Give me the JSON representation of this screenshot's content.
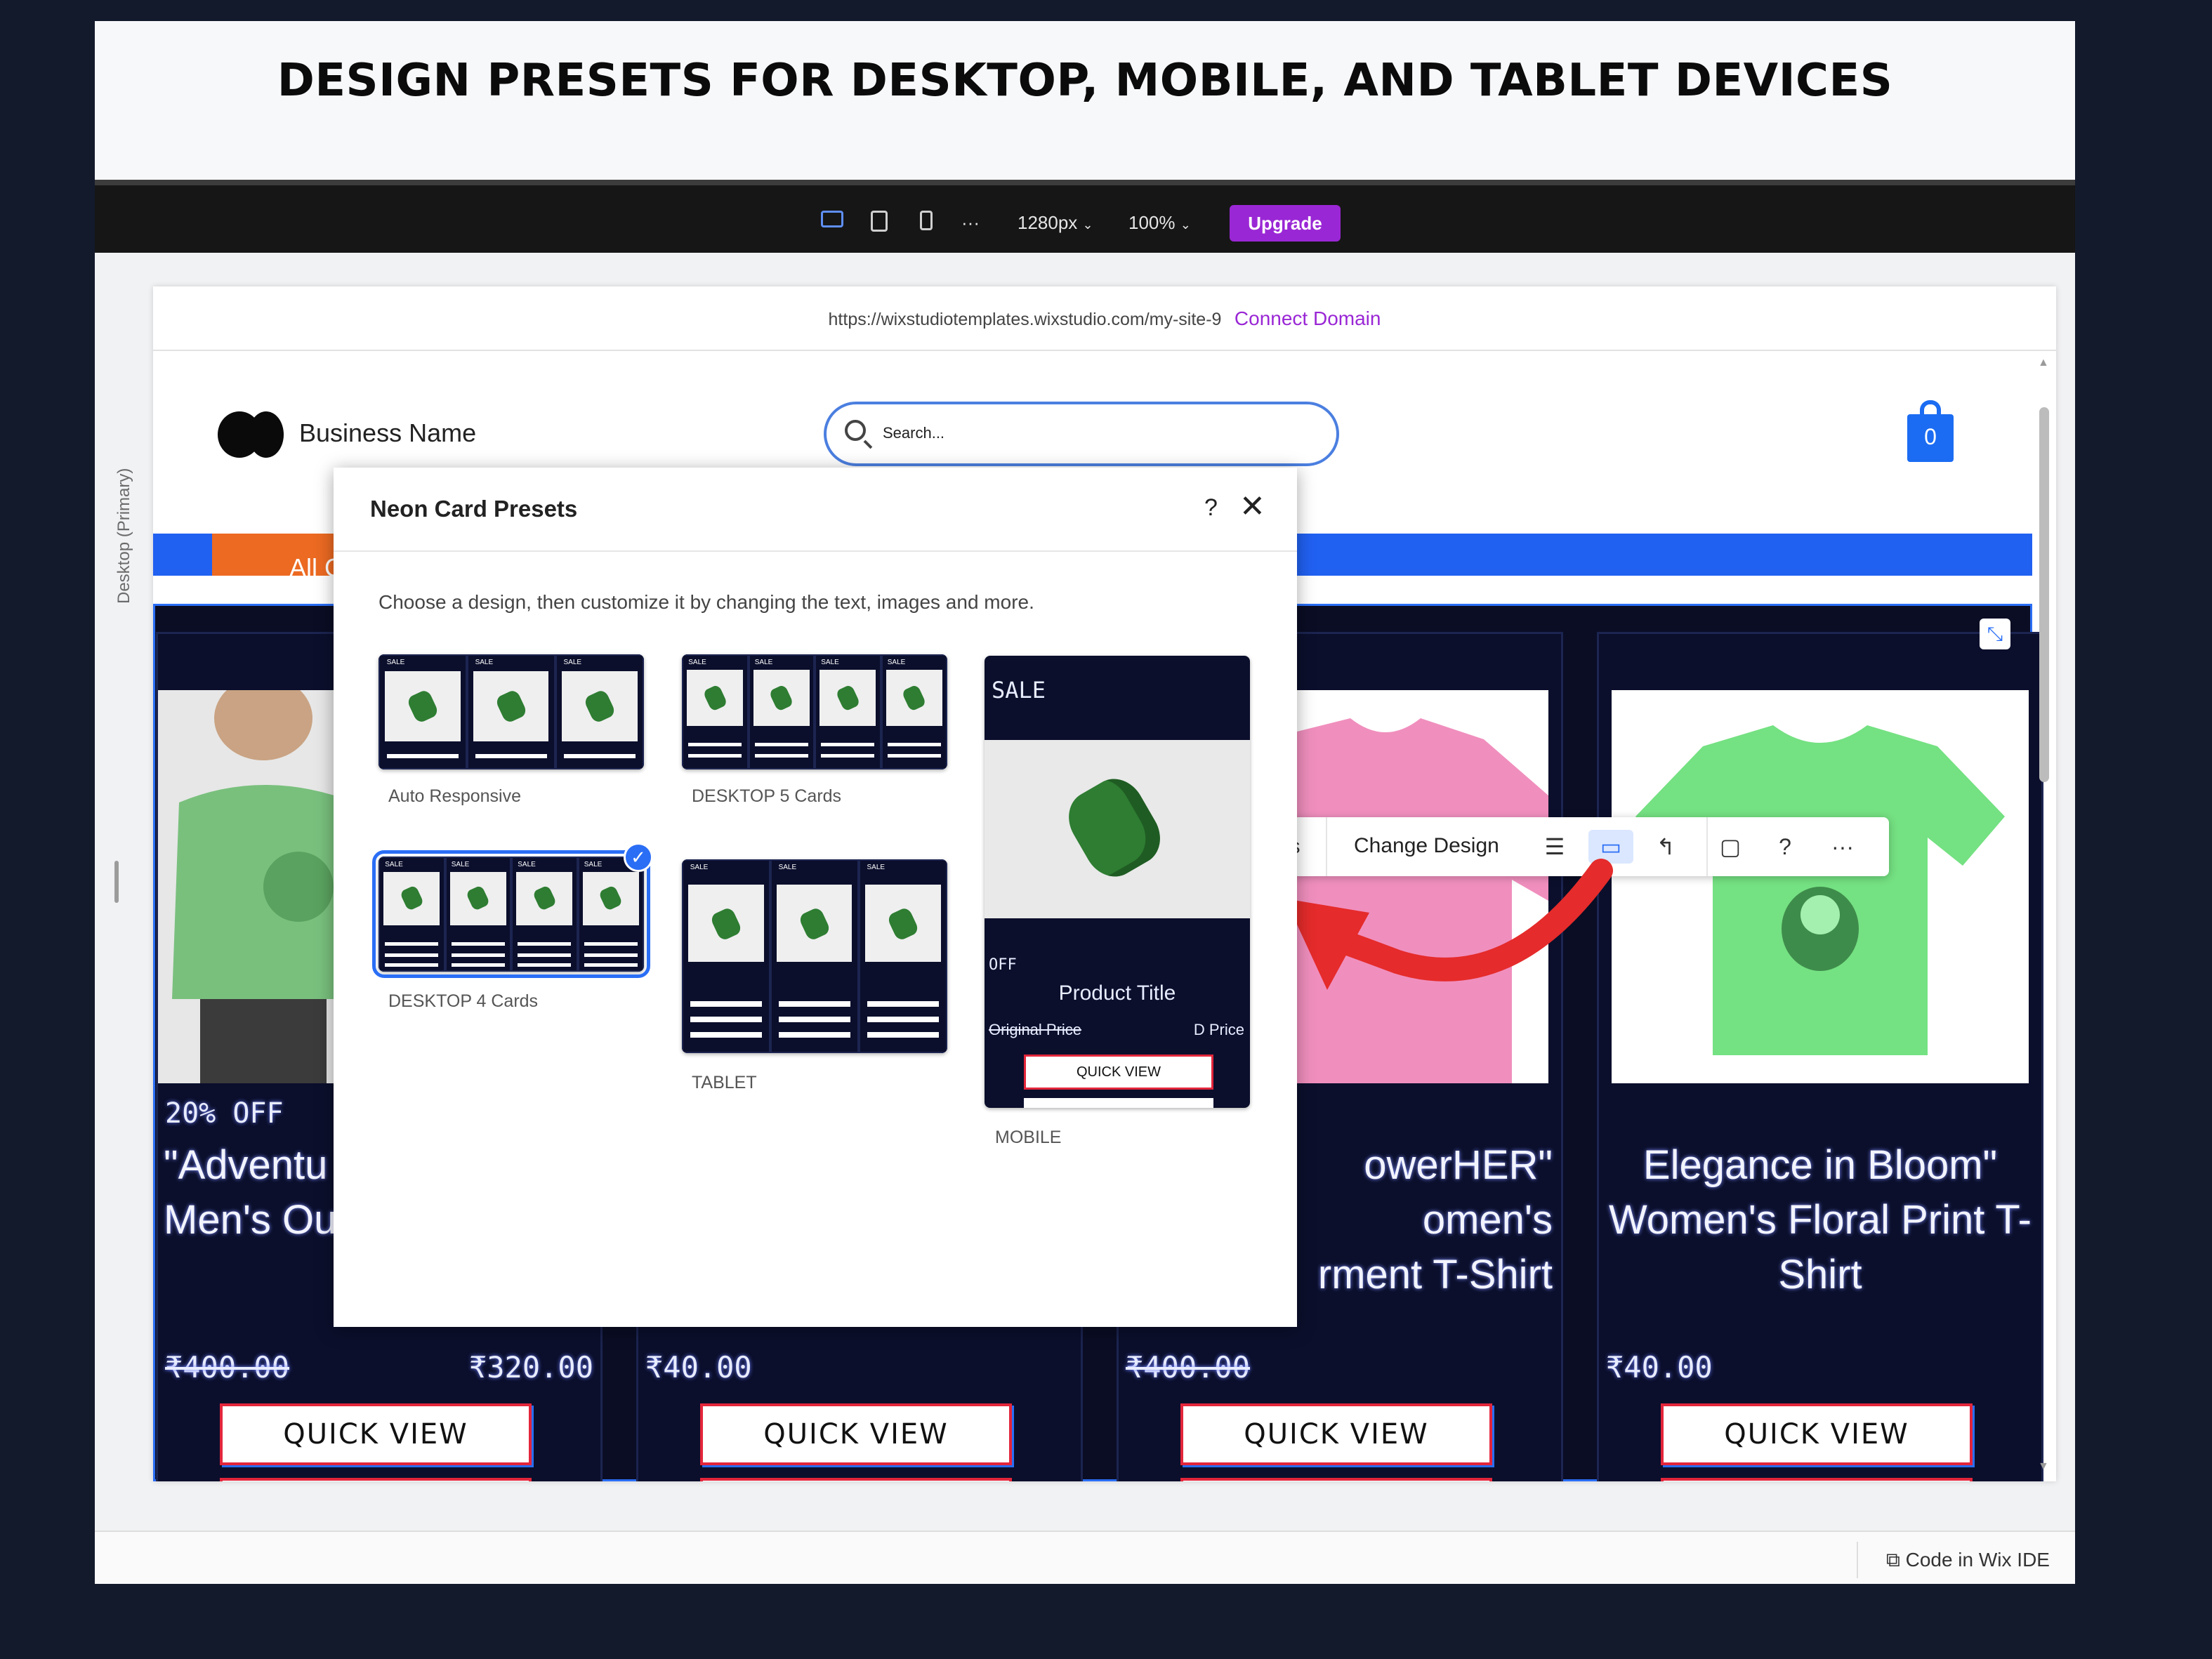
{
  "banner": {
    "title": "DESIGN PRESETS FOR DESKTOP, MOBILE, AND TABLET DEVICES"
  },
  "topbar": {
    "width_value": "1280px",
    "zoom_value": "100%",
    "more": "···",
    "upgrade_label": "Upgrade"
  },
  "workspace": {
    "side_label": "Desktop (Primary)",
    "code_ide_label": "Code in Wix IDE"
  },
  "browser": {
    "url": "https://wixstudiotemplates.wixstudio.com/my-site-9",
    "connect_label": "Connect Domain"
  },
  "site": {
    "business_name": "Business Name",
    "search_placeholder": "Search...",
    "cart_count": "0",
    "nav_tab_label": "All C"
  },
  "products": [
    {
      "badge": "20% OFF",
      "name": "\"Adventu\nMen's Ou",
      "original_price": "₹400.00",
      "price": "₹320.00",
      "quick_view": "QUICK VIEW"
    },
    {
      "badge": "",
      "name": "",
      "original_price": "₹40.00",
      "price": "",
      "quick_view": "QUICK VIEW"
    },
    {
      "badge": "",
      "name": "owerHER\"\nomen's\nrment T-Shirt",
      "original_price": "₹400.00",
      "price": "",
      "quick_view": "QUICK VIEW"
    },
    {
      "badge": "",
      "name": "Elegance in Bloom\"\nWomen's Floral Print T-\nShirt",
      "original_price": "₹40.00",
      "price": "",
      "quick_view": "QUICK VIEW"
    }
  ],
  "floating_toolbar": {
    "partial_label": "s",
    "change_design_label": "Change Design",
    "help": "?",
    "more": "···"
  },
  "modal": {
    "title": "Neon Card Presets",
    "help": "?",
    "close": "✕",
    "description": "Choose a design, then customize it by changing the text, images and more.",
    "presets": [
      {
        "label": "Auto Responsive"
      },
      {
        "label": "DESKTOP 5 Cards"
      },
      {
        "label": "DESKTOP 4 Cards",
        "selected": true
      },
      {
        "label": "TABLET"
      },
      {
        "label": "MOBILE"
      }
    ],
    "mobile_card": {
      "sale": "SALE",
      "off": "OFF",
      "title": "Product Title",
      "original_price": "Original Price",
      "price": "D Price",
      "quick_view": "QUICK VIEW"
    }
  },
  "colors": {
    "accent_purple": "#9a27d5",
    "accent_blue": "#2a6ef5",
    "arrow_red": "#e52b2b",
    "nav_orange": "#ec6a22"
  }
}
